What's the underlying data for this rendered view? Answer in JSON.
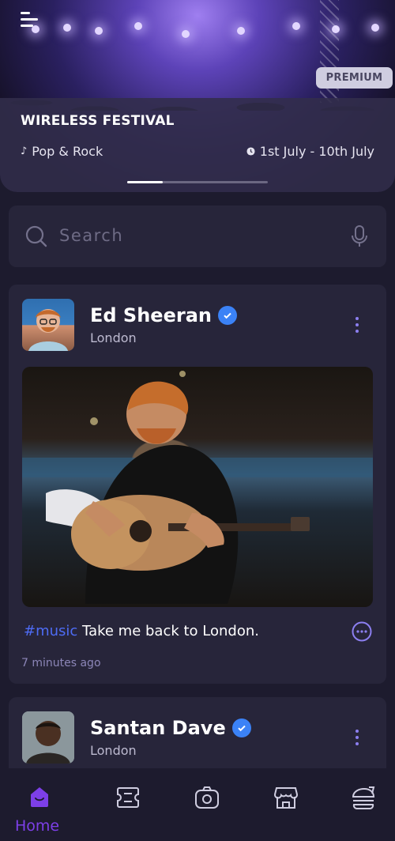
{
  "hero": {
    "badge": "PREMIUM",
    "title": "WIRELESS FESTIVAL",
    "genre": "Pop & Rock",
    "dates": "1st July - 10th July",
    "page_index": 1,
    "page_count": 4
  },
  "search": {
    "placeholder": "Search"
  },
  "posts": [
    {
      "name": "Ed Sheeran",
      "location": "London",
      "hashtag": "#music",
      "text": "Take me back to London.",
      "time": "7 minutes ago"
    },
    {
      "name": "Santan Dave",
      "location": "London"
    }
  ],
  "nav": {
    "items": [
      {
        "icon": "home-icon",
        "label": "Home",
        "active": true
      },
      {
        "icon": "ticket-icon"
      },
      {
        "icon": "camera-icon"
      },
      {
        "icon": "store-icon"
      },
      {
        "icon": "food-icon"
      }
    ],
    "active_color": "#7d3fe8"
  },
  "colors": {
    "accent": "#7d3fe8",
    "verified": "#3b82f6",
    "hashtag": "#4e6cf5",
    "card": "#27253a",
    "background": "#1d1b2e"
  }
}
